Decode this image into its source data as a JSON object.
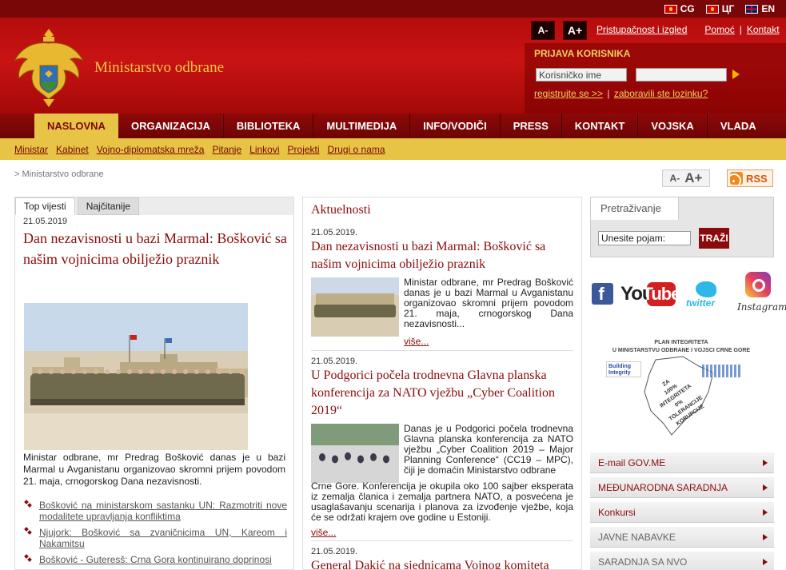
{
  "languages": [
    {
      "code": "CG",
      "flag": "me"
    },
    {
      "code": "ЦГ",
      "flag": "me"
    },
    {
      "code": "EN",
      "flag": "gb"
    }
  ],
  "header": {
    "site_title": "Ministarstvo odbrane",
    "font_decrease": "A-",
    "font_increase": "A+",
    "links": {
      "accessibility": "Pristupačnost i izgled",
      "help": "Pomoć",
      "contact": "Kontakt",
      "sep": "|"
    }
  },
  "login": {
    "title": "PRIJAVA KORISNIKA",
    "username_value": "Korisničko ime",
    "register_link": "registrujte se >>",
    "sep": "|",
    "forgot_link": "zaboravili ste lozinku?"
  },
  "main_nav": [
    "NASLOVNA",
    "ORGANIZACIJA",
    "BIBLIOTEKA",
    "MULTIMEDIJA",
    "INFO/VODIČI",
    "PRESS",
    "KONTAKT",
    "VOJSKA",
    "VLADA"
  ],
  "sub_nav": [
    "Ministar",
    "Kabinet",
    "Vojno-diplomatska mreža",
    "Pitanje",
    "Linkovi",
    "Projekti",
    "Drugi o nama"
  ],
  "breadcrumb": "> Ministarstvo odbrane",
  "page_font_controls": {
    "small": "A-",
    "large": "A+"
  },
  "rss_label": "RSS",
  "left": {
    "tabs": [
      "Top vijesti",
      "Najčitanije"
    ],
    "date": "21.05.2019",
    "headline": "Dan nezavisnosti u bazi Marmal: Bošković sa našim vojnicima obilježio praznik",
    "caption": "Ministar odbrane, mr Predrag Bošković danas je u bazi Marmal u Avganistanu organizovao skromni prijem povodom 21. maja, crnogorskog Dana nezavisnosti.",
    "list": [
      "Bošković na ministarskom sastanku UN: Razmotriti nove modalitete upravljanja konfliktima",
      "Njujork: Bošković sa zvaničnicima UN, Kareom i Nakamitsu",
      "Bošković - Guteresš: Crna Gora kontinuirano doprinosi"
    ]
  },
  "center": {
    "title": "Aktuelnosti",
    "more_label": "više...",
    "articles": [
      {
        "date": "21.05.2019.",
        "headline": "Dan nezavisnosti u bazi Marmal: Bošković sa našim vojnicima obilježio praznik",
        "text": "Ministar odbrane, mr Predrag Bošković danas je u bazi Marmal u Avganistanu organizovao skromni prijem povodom 21. maja, crnogorskog Dana nezavisnosti..."
      },
      {
        "date": "21.05.2019.",
        "headline": "U Podgorici počela trodnevna Glavna planska konferencija za NATO vježbu „Cyber Coalition 2019“",
        "text": "Danas je u Podgorici počela trodnevna Glavna planska konferencija za NATO vježbu „Cyber Coalition 2019 – Major Planning Conference“ (CC19 – MPC), čiji je domaćin Ministarstvo odbrane",
        "text_cont": "Crne Gore. Konferencija je okupila oko 100 sajber eksperata iz zemalja članica i zemalja partnera NATO, a posvećena je usaglašavanju scenarija i planova za izvođenje vježbe, koja će se održati krajem ove godine u Estoniji."
      },
      {
        "date": "21.05.2019.",
        "headline": "General Dakić na sjednicama Vojnog komiteta"
      }
    ]
  },
  "search": {
    "tab": "Pretraživanje",
    "input_value": "Unesite pojam:",
    "button": "TRAŽI"
  },
  "social": {
    "facebook": "f",
    "youtube_you": "You",
    "youtube_tube": "Tube",
    "twitter": "twitter",
    "instagram": "Instagram"
  },
  "integrity": {
    "title_line1": "PLAN INTEGRITETA",
    "title_line2": "U MINISTARSTVU ODBRANE I VOJSCI CRNE GORE",
    "logo_text": "Building Integrity",
    "map_line1": "ZA",
    "map_line2": "100%",
    "map_line3": "INTEGRITETA",
    "map_line4": "0%",
    "map_line5": "TOLERANCIJE",
    "map_line6": "KORUPCIJE"
  },
  "side_menu": [
    {
      "label": "E-mail GOV.ME",
      "style": "red"
    },
    {
      "label": "MEĐUNARODNA SARADNJA",
      "style": "red"
    },
    {
      "label": "Konkursi",
      "style": "red"
    },
    {
      "label": "JAVNE NABAVKE",
      "style": "gray"
    },
    {
      "label": "SARADNJA SA NVO",
      "style": "gray"
    }
  ],
  "colors": {
    "primary_red": "#8a0b0b",
    "header_red": "#c91313",
    "gold": "#e8c446",
    "title_gold": "#f0c84a"
  }
}
